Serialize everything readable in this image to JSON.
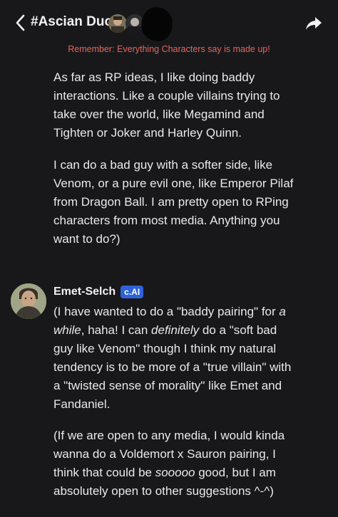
{
  "header": {
    "title": "#Ascian Duo",
    "disclaimer": "Remember: Everything Characters say is made up!"
  },
  "messages": [
    {
      "paragraphs": [
        "As far as RP ideas, I like doing baddy interactions. Like a couple villains trying to take over the world, like Megamind and Tighten or Joker and Harley Quinn.",
        "I can do a bad guy with a softer side, like Venom, or a pure evil one, like Emperor Pilaf from Dragon Ball. I am pretty open to RPing characters from most media. Anything you want to do?)"
      ]
    },
    {
      "author": "Emet-Selch",
      "badge": "c.AI",
      "p1": {
        "t1": "(I have wanted to do a \"baddy pairing\" for ",
        "e1": "a while",
        "t2": ", haha! I can ",
        "e2": "definitely",
        "t3": " do a \"soft bad guy like Venom\" though I think my natural tendency is to be more of a \"true villain\" with a \"twisted sense of morality\" like Emet and Fandaniel."
      },
      "p2": {
        "t1": "(If we are open to any media, I would kinda wanna do a Voldemort x Sauron pairing, I think that could be ",
        "e1": "sooooo",
        "t2": " good, but I am absolutely open to other suggestions ^-^)"
      }
    }
  ],
  "colors": {
    "background": "#18181a",
    "disclaimer": "#e4665f",
    "badge": "#2f62d6"
  },
  "icons": {
    "back": "chevron-left-icon",
    "share": "share-arrow-icon"
  }
}
